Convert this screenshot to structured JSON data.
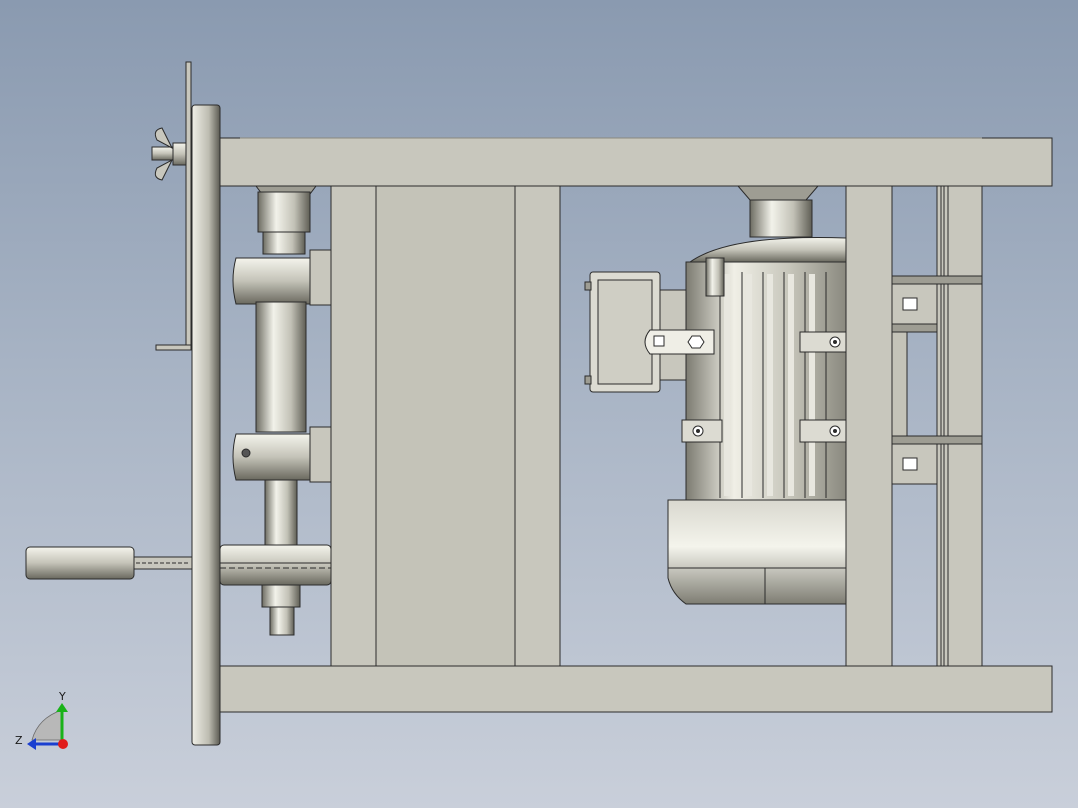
{
  "viewport": {
    "background_top": "#8a9ab0",
    "background_bottom": "#c9cfda"
  },
  "model": {
    "part_fill": "#c8c7bd",
    "part_edge": "#2b2b2b",
    "metal_highlight": "#f2f2ea",
    "metal_shadow": "#6d6c62"
  },
  "triad": {
    "y_label": "Y",
    "z_label": "Z",
    "y_color": "#19b219",
    "z_color": "#1a3fd0",
    "x_color": "#e01b1b"
  }
}
